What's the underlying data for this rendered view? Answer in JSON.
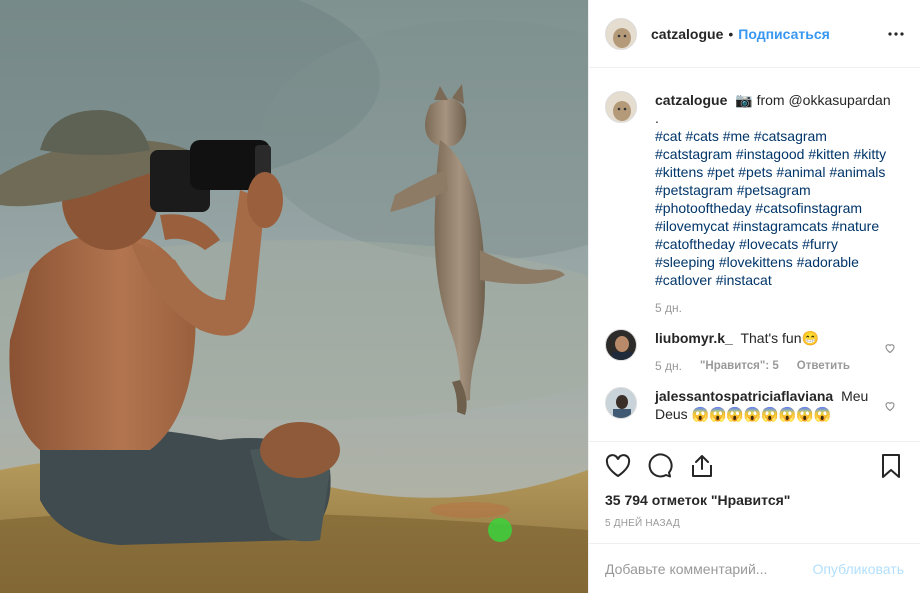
{
  "post": {
    "author": "catzalogue",
    "separator": "•",
    "follow_label": "Подписаться"
  },
  "caption": {
    "author": "catzalogue",
    "camera_emoji": "📷",
    "text": "from @okkasupardan",
    "dot_line": ".",
    "hashtags": "#cat #cats #me #catsagram #catstagram #instagood #kitten #kitty #kittens #pet #pets #animal #animals #petstagram #petsagram #photooftheday #catsofinstagram #ilovemycat #instagramcats #nature #catoftheday #lovecats #furry #sleeping #lovekittens #adorable #catlover #instacat",
    "time": "5 дн."
  },
  "comments": [
    {
      "user": "liubomyr.k_",
      "text": "That's fun😁",
      "time": "5 дн.",
      "likes": "\"Нравится\": 5",
      "reply": "Ответить"
    },
    {
      "user": "jalessantospatriciaflaviana",
      "text": "Meu Deus 😱😱😱😱😱😱😱😱"
    }
  ],
  "actions": {
    "like_count": "35 794 отметок \"Нравится\"",
    "time_ago": "5 дней назад"
  },
  "add_comment": {
    "placeholder": "Добавьте комментарий...",
    "post_label": "Опубликовать"
  },
  "colors": {
    "link": "#3897f0",
    "hashtag": "#003569",
    "muted": "#999999"
  },
  "icons": [
    "more-icon",
    "heart-icon",
    "comment-icon",
    "share-icon",
    "bookmark-icon"
  ]
}
